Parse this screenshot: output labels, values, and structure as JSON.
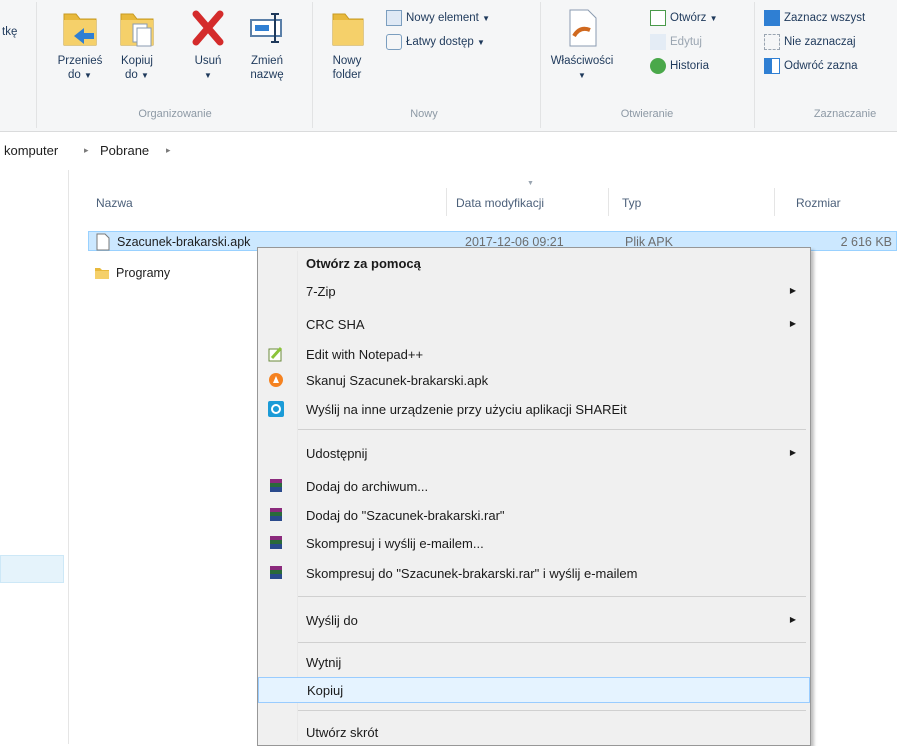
{
  "ribbon": {
    "partial_left": "tkę",
    "organize": {
      "move_to": [
        "Przenieś",
        "do"
      ],
      "copy_to": [
        "Kopiuj",
        "do"
      ],
      "delete": "Usuń",
      "rename": [
        "Zmień",
        "nazwę"
      ],
      "group_label": "Organizowanie"
    },
    "new": {
      "new_folder": [
        "Nowy",
        "folder"
      ],
      "new_item": "Nowy element",
      "easy_access": "Łatwy dostęp",
      "group_label": "Nowy"
    },
    "open": {
      "properties": "Właściwości",
      "open": "Otwórz",
      "edit": "Edytuj",
      "history": "Historia",
      "group_label": "Otwieranie"
    },
    "select": {
      "select_all": "Zaznacz wszyst",
      "select_none": "Nie zaznaczaj",
      "invert": "Odwróć zazna",
      "group_label": "Zaznaczanie"
    }
  },
  "breadcrumb": {
    "items": [
      "komputer",
      "Pobrane"
    ],
    "separator": "▸"
  },
  "columns": {
    "name": "Nazwa",
    "date": "Data modyfikacji",
    "type": "Typ",
    "size": "Rozmiar"
  },
  "files": [
    {
      "name": "Szacunek-brakarski.apk",
      "date": "2017-12-06 09:21",
      "type": "Plik APK",
      "size": "2 616 KB",
      "selected": true
    },
    {
      "name": "Programy",
      "date": "",
      "type": "",
      "size": "",
      "selected": false
    }
  ],
  "context_menu": {
    "items": [
      {
        "label": "Otwórz za pomocą",
        "bold": true,
        "submenu": false,
        "icon": ""
      },
      {
        "label": "7-Zip",
        "submenu": true,
        "icon": ""
      },
      {
        "label": "CRC SHA",
        "submenu": true,
        "icon": ""
      },
      {
        "label": "Edit with Notepad++",
        "submenu": false,
        "icon": "notepadpp-icon"
      },
      {
        "label": "Skanuj Szacunek-brakarski.apk",
        "submenu": false,
        "icon": "avast-icon"
      },
      {
        "label": "Wyślij na inne urządzenie przy użyciu aplikacji SHAREit",
        "submenu": false,
        "icon": "shareit-icon"
      },
      {
        "label": "Udostępnij",
        "submenu": true,
        "icon": ""
      },
      {
        "label": "Dodaj do archiwum...",
        "submenu": false,
        "icon": "winrar-icon"
      },
      {
        "label": "Dodaj do \"Szacunek-brakarski.rar\"",
        "submenu": false,
        "icon": "winrar-icon"
      },
      {
        "label": "Skompresuj i wyślij e-mailem...",
        "submenu": false,
        "icon": "winrar-icon"
      },
      {
        "label": "Skompresuj do \"Szacunek-brakarski.rar\" i wyślij e-mailem",
        "submenu": false,
        "icon": "winrar-icon"
      },
      {
        "label": "Wyślij do",
        "submenu": true,
        "icon": ""
      },
      {
        "label": "Wytnij",
        "submenu": false,
        "icon": ""
      },
      {
        "label": "Kopiuj",
        "submenu": false,
        "icon": "",
        "highlighted": true
      },
      {
        "label": "Utwórz skrót",
        "submenu": false,
        "icon": ""
      }
    ]
  },
  "colors": {
    "selection": "#cce8ff",
    "menu_highlight": "#e5f3ff",
    "ribbon_text": "#1e395b"
  }
}
